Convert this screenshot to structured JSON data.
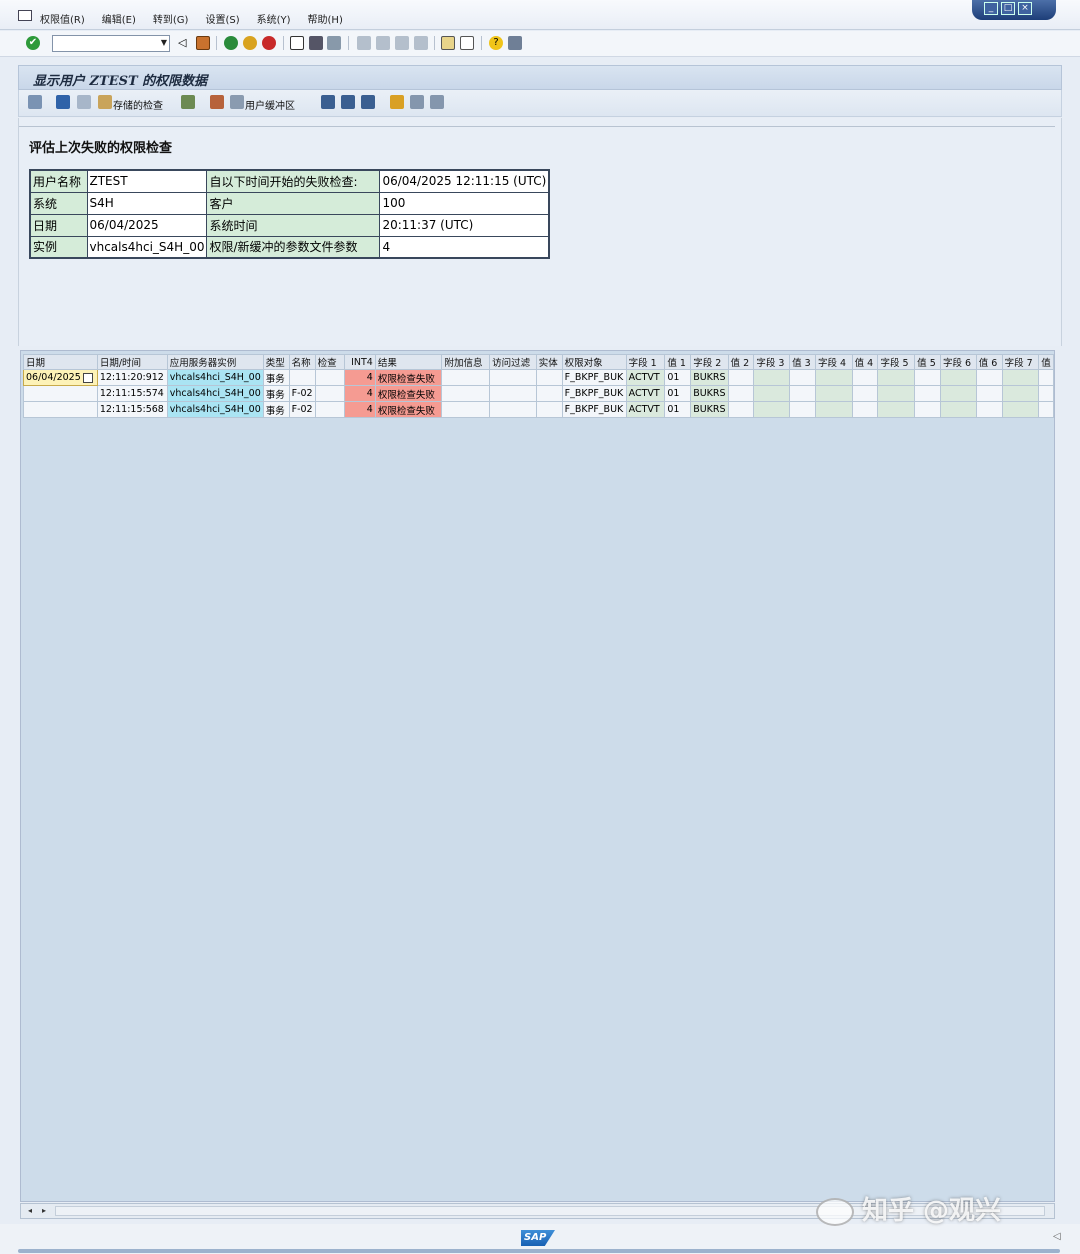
{
  "menubar": {
    "items": [
      "权限值(R)",
      "编辑(E)",
      "转到(G)",
      "设置(S)",
      "系统(Y)",
      "帮助(H)"
    ]
  },
  "window_controls": [
    "_",
    "□",
    "×"
  ],
  "title": "显示用户 ZTEST 的权限数据",
  "app_toolbar": {
    "stored_checks_label": "存储的检查",
    "user_buffer_label": "用户缓冲区"
  },
  "header": {
    "heading": "评估上次失败的权限检查",
    "rows": [
      {
        "k1": "用户名称",
        "v1": "ZTEST",
        "k2": "自以下时间开始的失败检查:",
        "v2": "06/04/2025 12:11:15 (UTC)"
      },
      {
        "k1": "系统",
        "v1": "S4H",
        "k2": "客户",
        "v2": "100"
      },
      {
        "k1": "日期",
        "v1": "06/04/2025",
        "k2": "系统时间",
        "v2": "20:11:37 (UTC)"
      },
      {
        "k1": "实例",
        "v1": "vhcals4hci_S4H_00",
        "k2": "权限/新缓冲的参数文件参数",
        "v2": "4"
      }
    ]
  },
  "grid": {
    "columns": [
      "日期",
      "日期/时间",
      "应用服务器实例",
      "类型",
      "名称",
      "检查",
      "INT4",
      "结果",
      "附加信息",
      "访问过滤",
      "实体",
      "权限对象",
      "字段 1",
      "值 1",
      "字段 2",
      "值 2",
      "字段 3",
      "值 3",
      "字段 4",
      "值 4",
      "字段 5",
      "值 5",
      "字段 6",
      "值 6",
      "字段 7",
      "值"
    ],
    "rows": [
      {
        "date": "06/04/2025",
        "datetime": "12:11:20:912",
        "instance": "vhcals4hci_S4H_00",
        "type": "事务",
        "name": "",
        "check": "",
        "int4": "4",
        "result": "权限检查失败",
        "extra": "",
        "filter": "",
        "entity": "",
        "object": "F_BKPF_BUK",
        "field1": "ACTVT",
        "val1": "01",
        "field2": "BUKRS"
      },
      {
        "date": "",
        "datetime": "12:11:15:574",
        "instance": "vhcals4hci_S4H_00",
        "type": "事务",
        "name": "F-02",
        "check": "",
        "int4": "4",
        "result": "权限检查失败",
        "extra": "",
        "filter": "",
        "entity": "",
        "object": "F_BKPF_BUK",
        "field1": "ACTVT",
        "val1": "01",
        "field2": "BUKRS"
      },
      {
        "date": "",
        "datetime": "12:11:15:568",
        "instance": "vhcals4hci_S4H_00",
        "type": "事务",
        "name": "F-02",
        "check": "",
        "int4": "4",
        "result": "权限检查失败",
        "extra": "",
        "filter": "",
        "entity": "",
        "object": "F_BKPF_BUK",
        "field1": "ACTVT",
        "val1": "01",
        "field2": "BUKRS"
      }
    ]
  },
  "status": {
    "sap_logo": "SAP"
  },
  "watermark": "知乎 @观兴",
  "colors": {
    "cyan_cell": "#aae4f3",
    "red_cell": "#f59b92",
    "green_cell": "#dae9dd",
    "selected_cell": "#fdf2b7"
  }
}
